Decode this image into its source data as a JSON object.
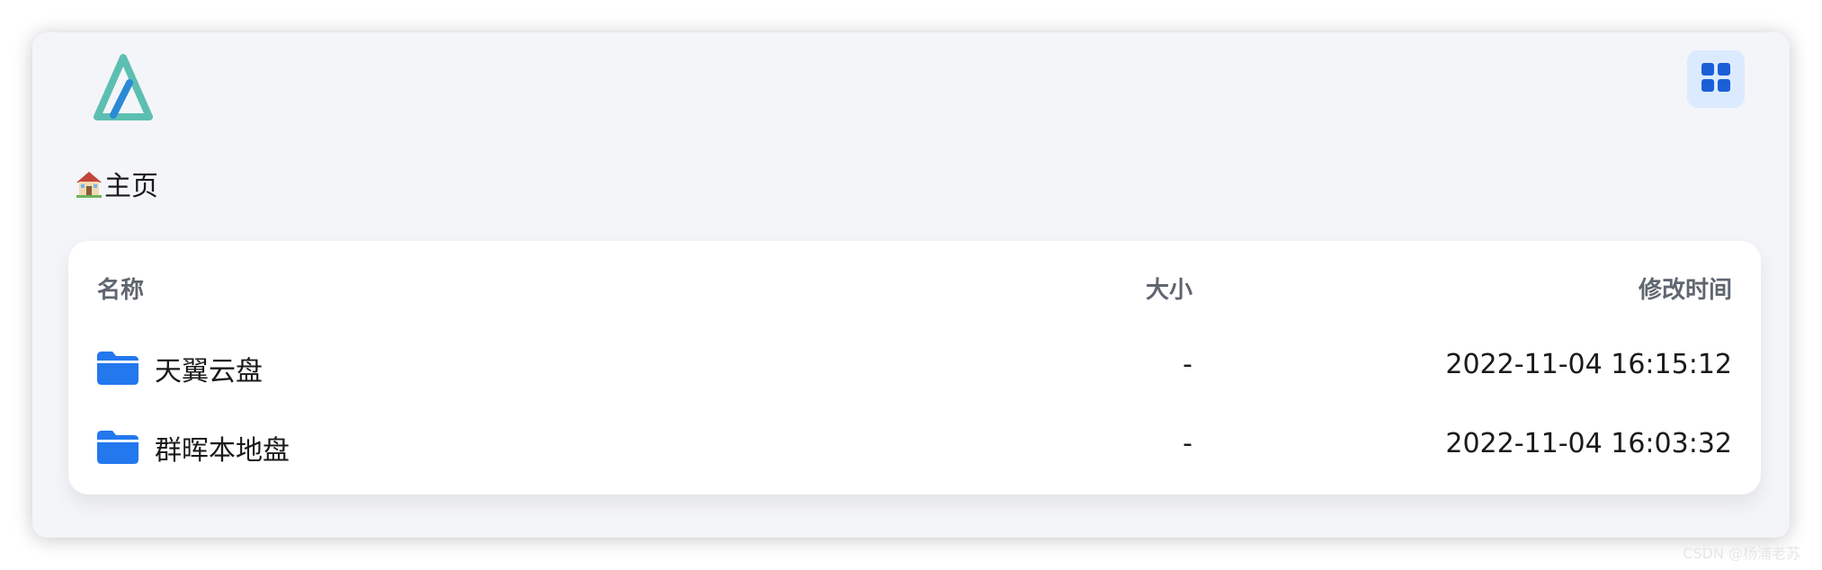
{
  "header": {
    "logo_icon": "alist-logo",
    "layout_toggle_icon": "grid-icon"
  },
  "breadcrumb": {
    "icon": "house-icon",
    "label": "主页"
  },
  "table": {
    "columns": {
      "name": "名称",
      "size": "大小",
      "modified": "修改时间"
    },
    "rows": [
      {
        "icon": "folder-icon",
        "name": "天翼云盘",
        "size": "-",
        "modified": "2022-11-04 16:15:12"
      },
      {
        "icon": "folder-icon",
        "name": "群晖本地盘",
        "size": "-",
        "modified": "2022-11-04 16:03:32"
      }
    ]
  },
  "watermark": "CSDN @杨浦老苏",
  "colors": {
    "accent": "#1e6ee8",
    "background": "#f4f5f9",
    "logo_teal": "#5cbfb2",
    "logo_blue": "#2a8ad6"
  }
}
